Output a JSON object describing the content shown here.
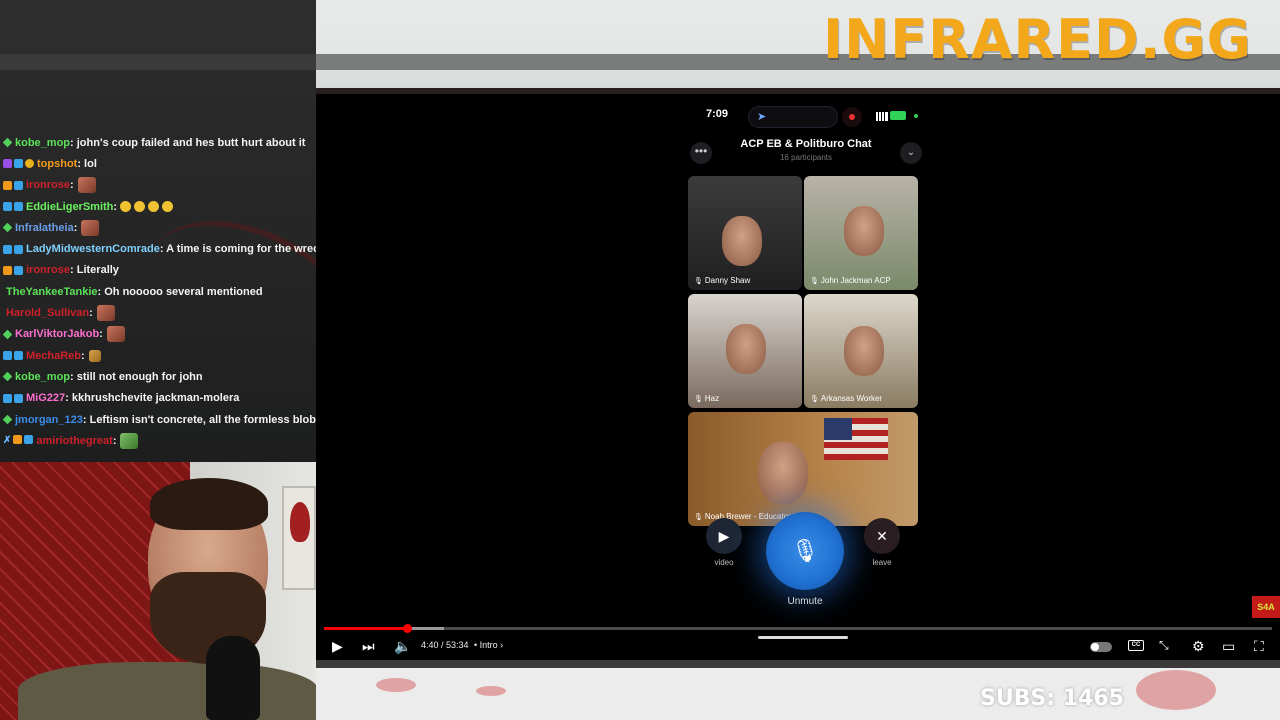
{
  "brand": {
    "text": "INFRARED.GG"
  },
  "subs": {
    "label": "SUBS: 1465"
  },
  "chat": {
    "messages": [
      {
        "user": "kobe_mop",
        "user_color": "#5de35a",
        "badges": [
          "green"
        ],
        "text": ": john's coup failed and hes butt hurt about it"
      },
      {
        "user": "topshot",
        "user_color": "#f39c1c",
        "badges": [
          "purple",
          "blue",
          "gold"
        ],
        "text": " : lol"
      },
      {
        "user": "ironrose",
        "user_color": "#d0202a",
        "badges": [
          "orange",
          "blue"
        ],
        "text": " :",
        "emote": "emote"
      },
      {
        "user": "EddieLigerSmith",
        "user_color": "#6cf060",
        "badges": [
          "blue",
          "blue"
        ],
        "text": " :",
        "emoji": 4
      },
      {
        "user": "Infralatheia",
        "user_color": "#6b9ee8",
        "badges": [
          "green"
        ],
        "text": " :",
        "emote": "emote"
      },
      {
        "user": "LadyMidwesternComrade",
        "user_color": "#7fd0ff",
        "badges": [
          "blue",
          "blue"
        ],
        "text": " : A time is coming for the wreck"
      },
      {
        "user": "ironrose",
        "user_color": "#d0202a",
        "badges": [
          "orange",
          "blue"
        ],
        "text": " : Literally"
      },
      {
        "user": "TheYankeeTankie",
        "user_color": "#5de35a",
        "badges": [],
        "text": " : Oh nooooo several mentioned"
      },
      {
        "user": "Harold_Sullivan",
        "user_color": "#d0202a",
        "badges": [],
        "text": " :",
        "emote": "emote"
      },
      {
        "user": "KarlViktorJakob",
        "user_color": "#ff6fd0",
        "badges": [
          "green"
        ],
        "text": " :",
        "emote": "emote"
      },
      {
        "user": "MechaReb",
        "user_color": "#d0202a",
        "badges": [
          "blue",
          "blue"
        ],
        "text": " :",
        "emote": "small"
      },
      {
        "user": "kobe_mop",
        "user_color": "#5de35a",
        "badges": [
          "green"
        ],
        "text": " : still not enough for john"
      },
      {
        "user": "MiG227",
        "user_color": "#ff6fd0",
        "badges": [
          "blue",
          "blue"
        ],
        "text": " : kkhrushchevite jackman-molera"
      },
      {
        "user": "jmorgan_123",
        "user_color": "#3a8de8",
        "badges": [
          "green"
        ],
        "text": " : Leftism isn't concrete, all the formless blob \"l"
      },
      {
        "user": "amiriothegreat",
        "user_color": "#d0202a",
        "badges": [
          "blade",
          "orange",
          "blue"
        ],
        "text": " :",
        "emote": "green"
      }
    ]
  },
  "call": {
    "time": "7:09",
    "title": "ACP EB & Politburo Chat",
    "participants": "16 participants",
    "tiles": [
      {
        "label": "Danny Shaw"
      },
      {
        "label": "John Jackman ACP"
      },
      {
        "label": "Haz"
      },
      {
        "label": "Arkansas Worker"
      },
      {
        "label": "Noah Brewer - Educator Midwe..."
      }
    ],
    "video_label": "video",
    "unmute_label": "Unmute",
    "leave_label": "leave"
  },
  "player": {
    "timecode": "4:40 / 53:34",
    "chapter": "• Intro ›",
    "progress_fraction": 0.0875,
    "buffer_fraction": 0.127,
    "cc_label": "CC",
    "watermark": "S4A"
  }
}
